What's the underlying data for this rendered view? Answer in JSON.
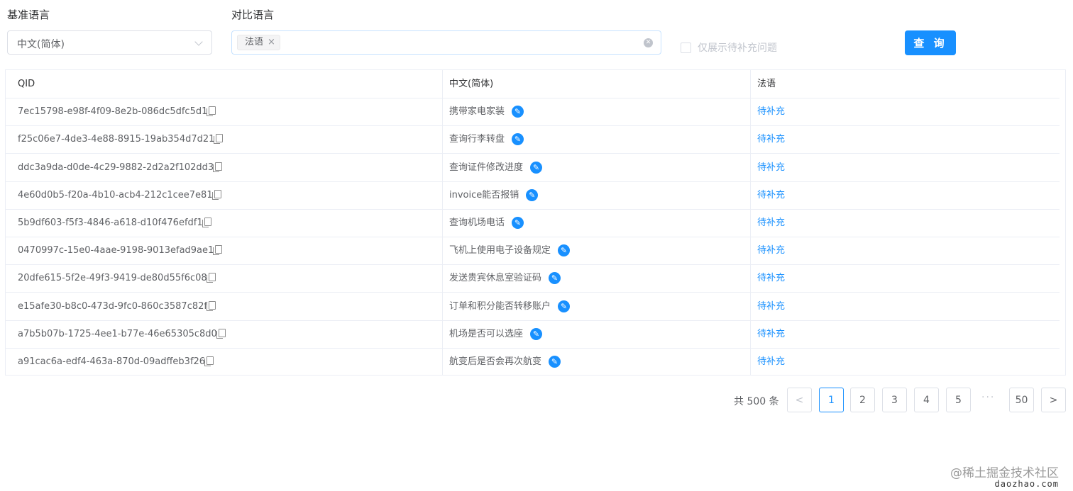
{
  "filters": {
    "base_label": "基准语言",
    "base_value": "中文(简体)",
    "compare_label": "对比语言",
    "compare_tags": [
      "法语"
    ],
    "only_pending_label": "仅展示待补充问题",
    "query_button": "查 询"
  },
  "table": {
    "headers": [
      "QID",
      "中文(简体)",
      "法语"
    ],
    "rows": [
      {
        "qid": "7ec15798-e98f-4f09-8e2b-086dc5dfc5d1",
        "zh": "携带家电家装",
        "fr": "待补充"
      },
      {
        "qid": "f25c06e7-4de3-4e88-8915-19ab354d7d21",
        "zh": "查询行李转盘",
        "fr": "待补充"
      },
      {
        "qid": "ddc3a9da-d0de-4c29-9882-2d2a2f102dd3",
        "zh": "查询证件修改进度",
        "fr": "待补充"
      },
      {
        "qid": "4e60d0b5-f20a-4b10-acb4-212c1cee7e81",
        "zh": "invoice能否报销",
        "fr": "待补充"
      },
      {
        "qid": "5b9df603-f5f3-4846-a618-d10f476efdf1",
        "zh": "查询机场电话",
        "fr": "待补充"
      },
      {
        "qid": "0470997c-15e0-4aae-9198-9013efad9ae1",
        "zh": "飞机上使用电子设备规定",
        "fr": "待补充"
      },
      {
        "qid": "20dfe615-5f2e-49f3-9419-de80d55f6c08",
        "zh": "发送贵宾休息室验证码",
        "fr": "待补充"
      },
      {
        "qid": "e15afe30-b8c0-473d-9fc0-860c3587c82f",
        "zh": "订单和积分能否转移账户",
        "fr": "待补充"
      },
      {
        "qid": "a7b5b07b-1725-4ee1-b77e-46e65305c8d0",
        "zh": "机场是否可以选座",
        "fr": "待补充"
      },
      {
        "qid": "a91cac6a-edf4-463a-870d-09adffeb3f26",
        "zh": "航变后是否会再次航变",
        "fr": "待补充"
      }
    ]
  },
  "pagination": {
    "total_text": "共 500 条",
    "pages": [
      "1",
      "2",
      "3",
      "4",
      "5",
      "50"
    ],
    "current": "1",
    "ellipsis": "···",
    "prev": "<",
    "next": ">"
  },
  "watermark": {
    "text": "@稀土掘金技术社区",
    "domain": "daozhao.com"
  },
  "icons": {
    "copy": "copy-icon",
    "edit": "edit-icon",
    "clear": "clear-icon",
    "dropdown": "chevron-down-icon"
  },
  "colors": {
    "primary": "#1890ff",
    "border": "#dcdfe6",
    "text": "#606266"
  }
}
